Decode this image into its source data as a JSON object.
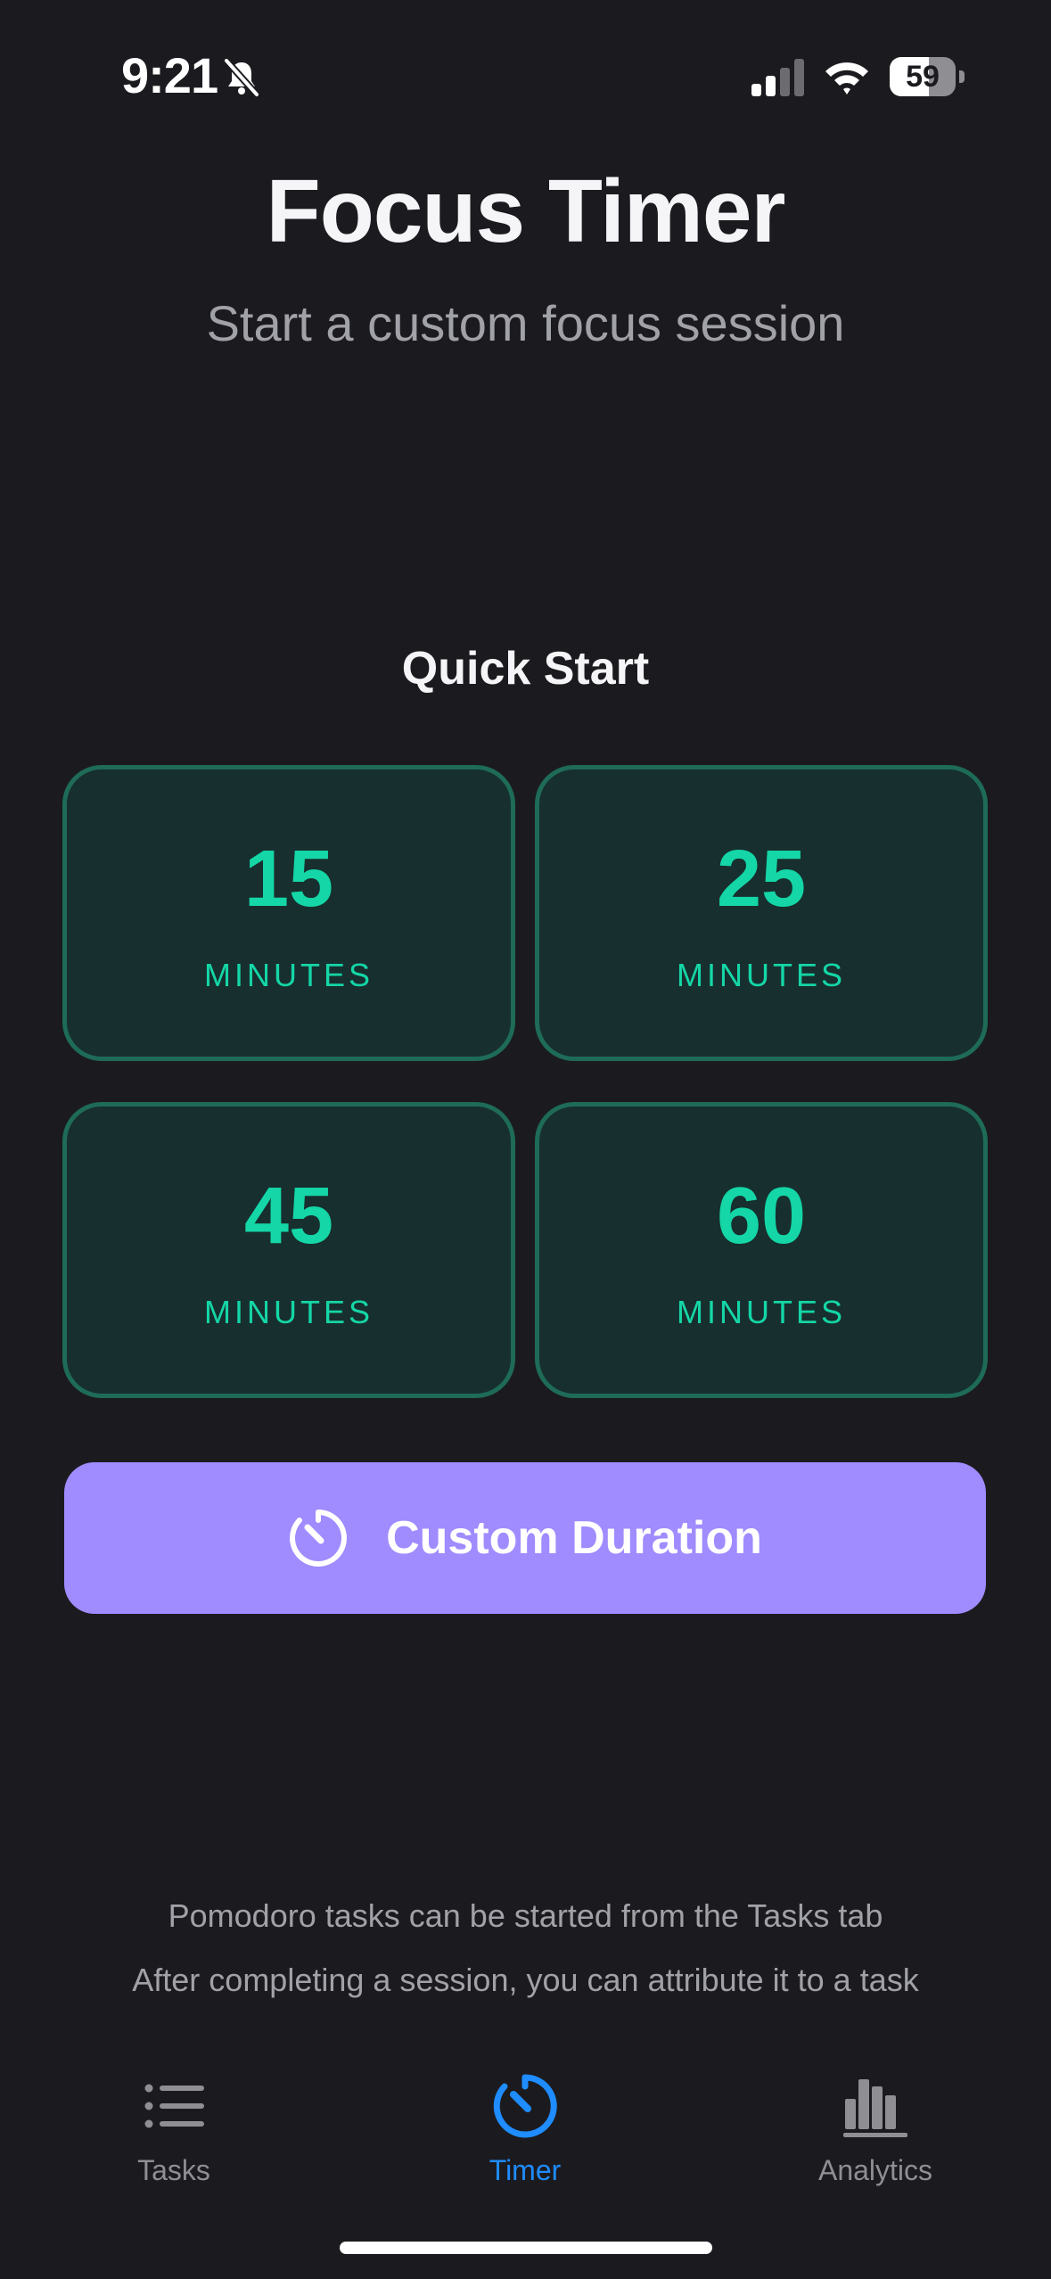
{
  "status_bar": {
    "time": "9:21",
    "battery_percent": "59",
    "battery_level": 0.59
  },
  "header": {
    "title": "Focus Timer",
    "subtitle": "Start a custom focus session"
  },
  "quick_start": {
    "title": "Quick Start",
    "presets": [
      {
        "value": "15",
        "unit": "MINUTES"
      },
      {
        "value": "25",
        "unit": "MINUTES"
      },
      {
        "value": "45",
        "unit": "MINUTES"
      },
      {
        "value": "60",
        "unit": "MINUTES"
      }
    ]
  },
  "custom_button": {
    "label": "Custom Duration",
    "icon": "timer-icon"
  },
  "hints": {
    "line1": "Pomodoro tasks can be started from the Tasks tab",
    "line2": "After completing a session, you can attribute it to a task"
  },
  "tab_bar": {
    "tabs": [
      {
        "label": "Tasks",
        "icon": "list-icon"
      },
      {
        "label": "Timer",
        "icon": "timer-icon",
        "active": true
      },
      {
        "label": "Analytics",
        "icon": "bar-chart-icon"
      }
    ]
  },
  "colors": {
    "background": "#1b1b1f",
    "accent_green": "#14d6a6",
    "card_border": "#1e6b58",
    "card_fill": "#172f2f",
    "button_purple": "#a08bff",
    "tab_active": "#1f8cff",
    "tab_inactive": "#8e8e93"
  }
}
